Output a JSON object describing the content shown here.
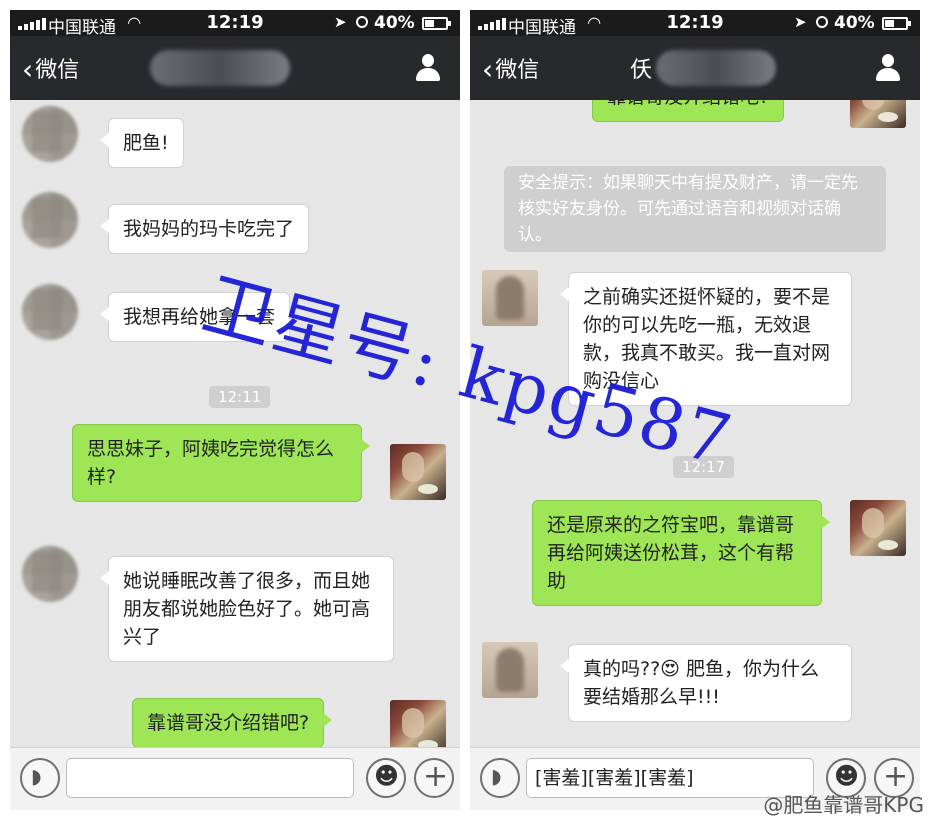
{
  "status": {
    "carrier": "中国联通",
    "time": "12:19",
    "battery": "40%"
  },
  "nav": {
    "back_label": "微信"
  },
  "left": {
    "messages": [
      {
        "text": "肥鱼!"
      },
      {
        "text": "我妈妈的玛卡吃完了"
      },
      {
        "text": "我想再给她拿一套"
      },
      {
        "text": "12:11"
      },
      {
        "text": "思思妹子，阿姨吃完觉得怎么样?"
      },
      {
        "text": "她说睡眠改善了很多，而且她朋友都说她脸色好了。她可高兴了"
      },
      {
        "text": "靠谱哥没介绍错吧?"
      }
    ],
    "input": {
      "value": ""
    }
  },
  "right": {
    "title_visible": "仸",
    "messages": [
      {
        "text": "靠谱哥没介绍错吧?"
      },
      {
        "text": "安全提示：如果聊天中有提及财产，请一定先核实好友身份。可先通过语音和视频对话确认。"
      },
      {
        "text": "之前确实还挺怀疑的，要不是你的可以先吃一瓶，无效退款，我真不敢买。我一直对网购没信心"
      },
      {
        "text": "12:17"
      },
      {
        "text": "还是原来的之符宝吧，靠谱哥再给阿姨送份松茸，这个有帮助"
      },
      {
        "text": "真的吗??😍 肥鱼，你为什么要结婚那么早!!!"
      }
    ],
    "input": {
      "value": "[害羞][害羞][害羞]"
    }
  },
  "overlay": {
    "watermark": "卫星号: kpg587",
    "signature": "@肥鱼靠谱哥KPG"
  },
  "colors": {
    "navbar": "#28292d",
    "statusbar": "#1b1b1b",
    "bubble_out": "#9fe657",
    "bubble_in": "#ffffff",
    "chat_bg": "#e6e6e6",
    "watermark": "#1b1bd8"
  }
}
